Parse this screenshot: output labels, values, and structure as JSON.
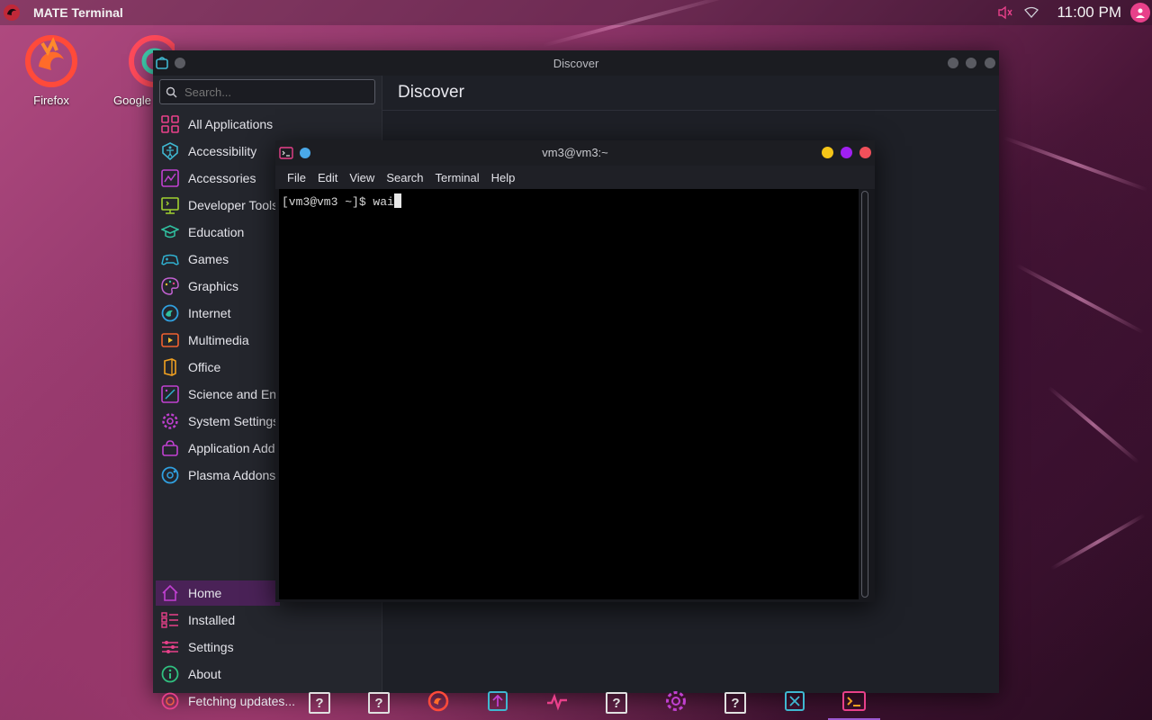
{
  "top_panel": {
    "active_app": "MATE Terminal",
    "clock": "11:00 PM"
  },
  "desktop_icons": [
    {
      "label": "Firefox"
    },
    {
      "label": "Google"
    }
  ],
  "discover": {
    "window_title": "Discover",
    "search_placeholder": "Search...",
    "main_title": "Discover",
    "categories": [
      "All Applications",
      "Accessibility",
      "Accessories",
      "Developer Tools",
      "Education",
      "Games",
      "Graphics",
      "Internet",
      "Multimedia",
      "Office",
      "Science and Eng",
      "System Settings",
      "Application Add",
      "Plasma Addons"
    ],
    "nav": [
      "Home",
      "Installed",
      "Settings",
      "About",
      "Fetching updates..."
    ]
  },
  "terminal": {
    "window_title": "vm3@vm3:~",
    "menu": [
      "File",
      "Edit",
      "View",
      "Search",
      "Terminal",
      "Help"
    ],
    "prompt": "[vm3@vm3 ~]$ ",
    "typed": "wai"
  },
  "dock": {
    "unknown_glyph": "?"
  },
  "colors": {
    "accent": "#9b59d0",
    "home_highlight": "#4a2257",
    "close": "#f0505a",
    "maximize": "#a020f0",
    "minimize": "#f5c518"
  }
}
